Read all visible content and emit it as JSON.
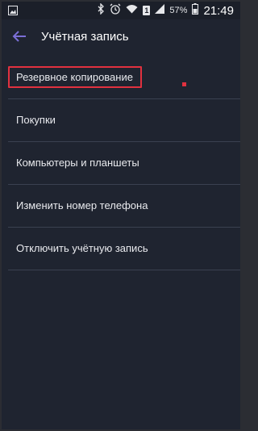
{
  "status_bar": {
    "left_icon": "gallery-icon",
    "icons": [
      "bluetooth-icon",
      "alarm-icon",
      "wifi-icon",
      "sim-icon",
      "signal-icon"
    ],
    "sim_label": "1",
    "battery_percent": "57%",
    "time": "21:49"
  },
  "app_bar": {
    "back_icon": "arrow-left-icon",
    "title": "Учётная запись"
  },
  "menu": {
    "items": [
      {
        "label": "Резервное копирование",
        "highlighted": true
      },
      {
        "label": "Покупки"
      },
      {
        "label": "Компьютеры и планшеты"
      },
      {
        "label": "Изменить номер телефона"
      },
      {
        "label": "Отключить учётную запись"
      }
    ]
  },
  "colors": {
    "background": "#1f2430",
    "accent": "#7b6fd6",
    "highlight": "#e1313f",
    "divider": "#3a4150"
  }
}
